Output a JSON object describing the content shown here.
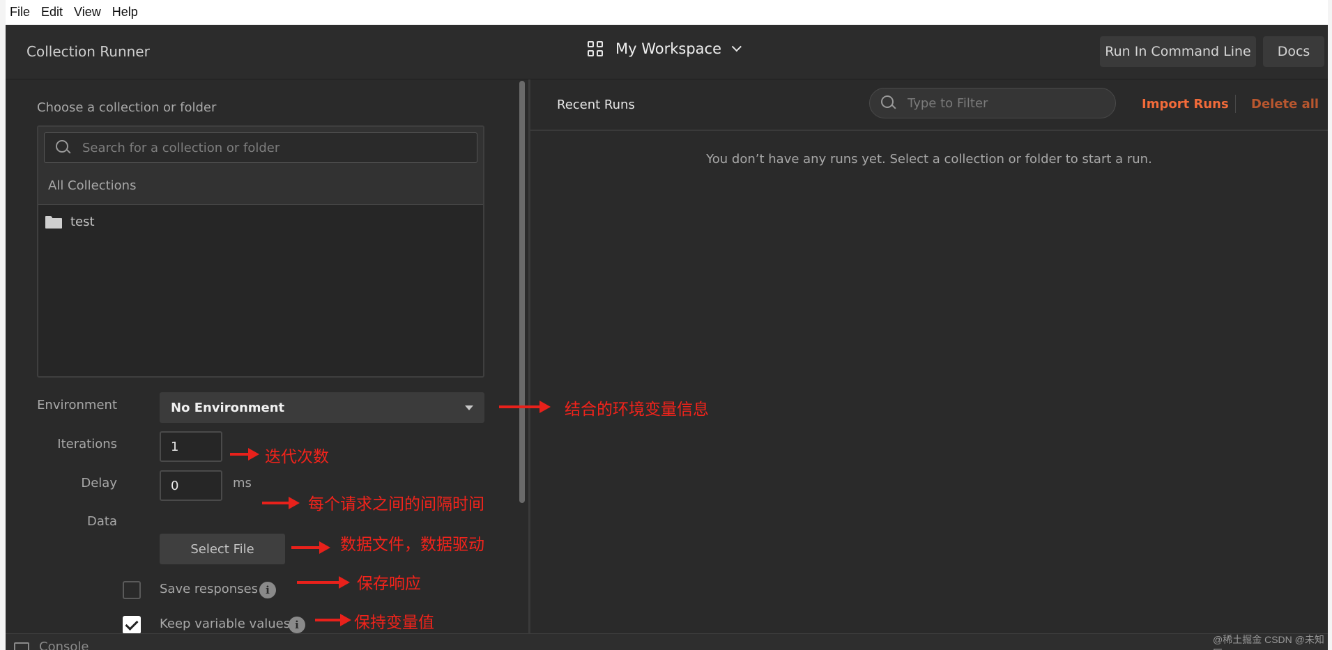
{
  "menubar": {
    "items": [
      "File",
      "Edit",
      "View",
      "Help"
    ]
  },
  "header": {
    "title": "Collection Runner",
    "workspace": "My Workspace",
    "run_cmdline": "Run In Command Line",
    "docs": "Docs"
  },
  "left": {
    "choose_label": "Choose a collection or folder",
    "search_placeholder": "Search for a collection or folder",
    "all_collections": "All Collections",
    "collections": [
      "test"
    ],
    "environment_label": "Environment",
    "environment_value": "No Environment",
    "iterations_label": "Iterations",
    "iterations_value": "1",
    "delay_label": "Delay",
    "delay_value": "0",
    "delay_unit": "ms",
    "data_label": "Data",
    "select_file": "Select File",
    "save_responses": "Save responses",
    "save_responses_checked": false,
    "keep_values": "Keep variable values",
    "keep_values_checked": true
  },
  "right": {
    "title": "Recent Runs",
    "filter_placeholder": "Type to Filter",
    "import_runs": "Import Runs",
    "delete_all": "Delete all",
    "empty_message": "You don’t have any runs yet. Select a collection or folder to start a run."
  },
  "bottom": {
    "console": "Console"
  },
  "annotations": {
    "environment": "结合的环境变量信息",
    "iterations": "迭代次数",
    "delay": "每个请求之间的间隔时间",
    "data": "数据文件，数据驱动",
    "save": "保存响应",
    "keep": "保持变量值"
  },
  "watermark": "@稀土掘金 CSDN @未知匠",
  "colors": {
    "accent": "#f26b3a",
    "annotation": "#e8211b",
    "bg": "#2a2a2a"
  }
}
